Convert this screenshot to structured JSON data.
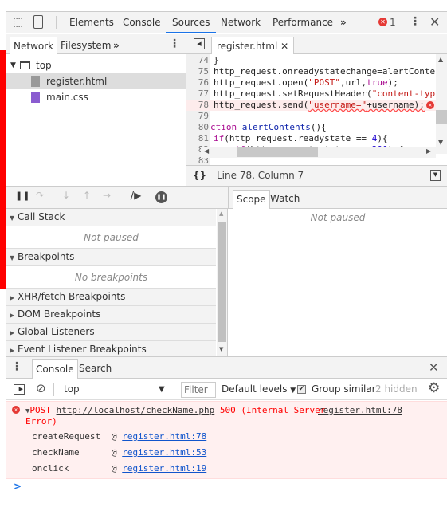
{
  "toolbar": {
    "tabs": [
      "Elements",
      "Console",
      "Sources",
      "Network",
      "Performance"
    ],
    "active_tab": "Sources",
    "more": "»",
    "error_count": "1"
  },
  "navigator": {
    "tabs": [
      "Network",
      "Filesystem"
    ],
    "more": "»",
    "tree": [
      {
        "label": "top",
        "icon": "frame-icon"
      },
      {
        "label": "register.html",
        "icon": "html-file-icon",
        "selected": true
      },
      {
        "label": "main.css",
        "icon": "css-file-icon"
      }
    ]
  },
  "editor": {
    "tab": "register.html",
    "status": "Line 78, Column 7",
    "lines": [
      {
        "n": "74",
        "tokens": [
          [
            "}",
            "p"
          ]
        ]
      },
      {
        "n": "75",
        "tokens": [
          [
            "http_request.onreadystatechange=alertConte",
            "p"
          ]
        ]
      },
      {
        "n": "76",
        "tokens": [
          [
            "http_request.open(",
            "p"
          ],
          [
            "\"POST\"",
            "s"
          ],
          [
            ",url,",
            "p"
          ],
          [
            "true",
            "k"
          ],
          [
            ");",
            "p"
          ]
        ]
      },
      {
        "n": "77",
        "tokens": [
          [
            "http_request.setRequestHeader(",
            "p"
          ],
          [
            "\"content-typ",
            "s"
          ]
        ]
      },
      {
        "n": "78",
        "tokens": [
          [
            "http_request.send(",
            "p"
          ],
          [
            "\"username=\"",
            "s"
          ],
          [
            "+username);",
            "p"
          ]
        ],
        "error": true
      },
      {
        "n": "79",
        "tokens": []
      },
      {
        "n": "80",
        "tokens": [
          [
            "ction ",
            "k"
          ],
          [
            "alertContents",
            "f"
          ],
          [
            "(){",
            "p"
          ]
        ],
        "offset": true
      },
      {
        "n": "81",
        "tokens": [
          [
            "if",
            "k"
          ],
          [
            "(http_request.readystate == ",
            "p"
          ],
          [
            "4",
            "n"
          ],
          [
            "){",
            "p"
          ]
        ]
      },
      {
        "n": "82",
        "tokens": [
          [
            "    ",
            "p"
          ],
          [
            "if",
            "k"
          ],
          [
            "(http_request.status == ",
            "p"
          ],
          [
            "200",
            "n"
          ],
          [
            ") {",
            "p"
          ]
        ]
      },
      {
        "n": "83",
        "tokens": []
      }
    ]
  },
  "debugger": {
    "sections": [
      {
        "label": "Call Stack",
        "open": true,
        "empty": "Not paused"
      },
      {
        "label": "Breakpoints",
        "open": true,
        "empty": "No breakpoints"
      },
      {
        "label": "XHR/fetch Breakpoints",
        "open": false
      },
      {
        "label": "DOM Breakpoints",
        "open": false
      },
      {
        "label": "Global Listeners",
        "open": false
      },
      {
        "label": "Event Listener Breakpoints",
        "open": false
      }
    ],
    "right_tabs": [
      "Scope",
      "Watch"
    ],
    "right_empty": "Not paused"
  },
  "drawer": {
    "tabs": [
      "Console",
      "Search"
    ],
    "context": "top",
    "filter_placeholder": "Filter",
    "levels": "Default levels",
    "group_similar": "Group similar",
    "group_checked": true,
    "hidden": "2 hidden",
    "error": {
      "method": "POST",
      "url": "http://localhost/checkName.php",
      "rest": "500 (Internal Server",
      "rest2": "Error)",
      "source": "register.html:78",
      "stack": [
        {
          "fn": "createRequest",
          "at": "@",
          "link": "register.html:78"
        },
        {
          "fn": "checkName",
          "at": "@",
          "link": "register.html:53"
        },
        {
          "fn": "onclick",
          "at": "@",
          "link": "register.html:19"
        }
      ]
    },
    "prompt": ">"
  },
  "colors": {
    "accent": "#1a73e8",
    "error_bg": "#fff0f0",
    "error_text": "#ff0000",
    "string": "#c41a16",
    "keyword": "#aa0d91",
    "number": "#1c00cf"
  }
}
